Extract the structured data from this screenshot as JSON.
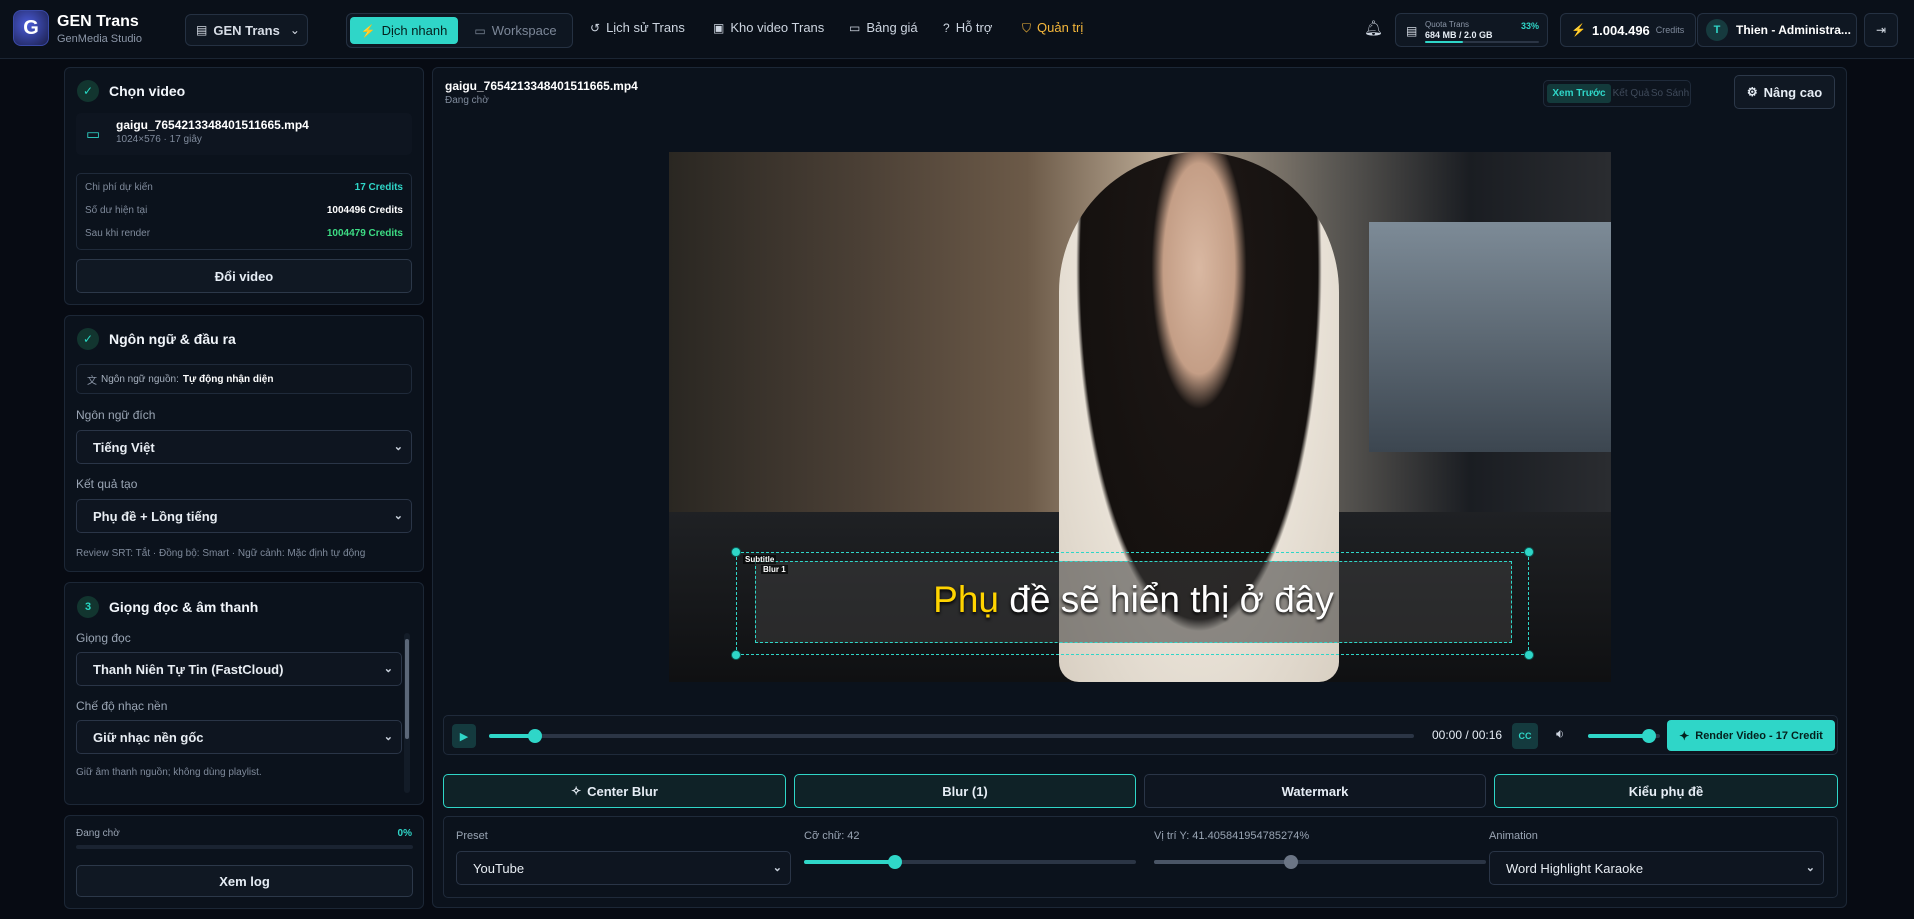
{
  "brand": {
    "title": "GEN Trans",
    "subtitle": "GenMedia Studio",
    "logo_letter": "G"
  },
  "workspace_selector": {
    "label": "GEN Trans"
  },
  "mode_tabs": [
    {
      "label": "Dịch nhanh"
    },
    {
      "label": "Workspace"
    }
  ],
  "nav": [
    {
      "label": "Lịch sử Trans"
    },
    {
      "label": "Kho video Trans"
    },
    {
      "label": "Bảng giá"
    },
    {
      "label": "Hỗ trợ"
    },
    {
      "label": "Quản trị"
    }
  ],
  "quota": {
    "label": "Quota Trans",
    "value": "684 MB / 2.0 GB",
    "percent_label": "33%",
    "percent": 0.33
  },
  "credits": {
    "value": "1.004.496",
    "label": "Credits"
  },
  "user": {
    "initial": "T",
    "name": "Thien - Administra..."
  },
  "choose_video": {
    "title": "Chọn video",
    "file_name": "gaigu_7654213348401511665.mp4",
    "file_meta": "1024×576 · 17 giây",
    "rows": [
      {
        "label": "Chi phí dự kiến",
        "value": "17 Credits",
        "color": "#2fd6c8"
      },
      {
        "label": "Số dư hiện tại",
        "value": "1004496 Credits",
        "color": "#ffffff"
      },
      {
        "label": "Sau khi render",
        "value": "1004479 Credits",
        "color": "#3ddc84"
      }
    ],
    "change_button": "Đổi video"
  },
  "language": {
    "title": "Ngôn ngữ & đầu ra",
    "source_label": "Ngôn ngữ nguồn:",
    "source_value": "Tự động nhận diện",
    "target_label": "Ngôn ngữ đích",
    "target_value": "Tiếng Việt",
    "result_label": "Kết quả tạo",
    "result_value": "Phụ đề + Lồng tiếng",
    "note": "Review SRT: Tắt · Đồng bộ: Smart · Ngữ cảnh: Mặc định tự động"
  },
  "voice": {
    "step": "3",
    "title": "Giọng đọc & âm thanh",
    "voice_label": "Giọng đọc",
    "voice_value": "Thanh Niên Tự Tin (FastCloud)",
    "music_label": "Chế độ nhạc nền",
    "music_value": "Giữ nhạc nền gốc",
    "note": "Giữ âm thanh nguồn; không dùng playlist."
  },
  "status": {
    "label": "Đang chờ",
    "percent_label": "0%",
    "log_button": "Xem log"
  },
  "preview": {
    "file_name": "gaigu_7654213348401511665.mp4",
    "status": "Đang chờ",
    "view_tabs": [
      {
        "label": "Xem Trước"
      },
      {
        "label": "Kết Quả"
      },
      {
        "label": "So Sánh"
      }
    ],
    "advanced_button": "Nâng cao",
    "subtitle_tag": "Subtitle",
    "blur_tag": "Blur 1",
    "subtitle_first_word": "Phụ",
    "subtitle_rest": " đề sẽ hiển thị ở đây",
    "time": "00:00 / 00:16",
    "progress": 0.05,
    "volume": 0.85,
    "render_button": "Render Video - 17 Credit"
  },
  "tool_tabs": [
    {
      "label": "Center Blur"
    },
    {
      "label": "Blur (1)"
    },
    {
      "label": "Watermark"
    },
    {
      "label": "Kiểu phụ đề"
    }
  ],
  "controls": {
    "preset_label": "Preset",
    "preset_value": "YouTube",
    "font_size_label": "Cỡ chữ: 42",
    "font_size": 42,
    "position_label": "Vị trí Y: 41.405841954785274%",
    "position": 41.405841954785274,
    "animation_label": "Animation",
    "animation_value": "Word Highlight Karaoke"
  },
  "colors": {
    "accent": "#2fd6c8",
    "admin": "#f5b73b",
    "background": "#070b13"
  }
}
